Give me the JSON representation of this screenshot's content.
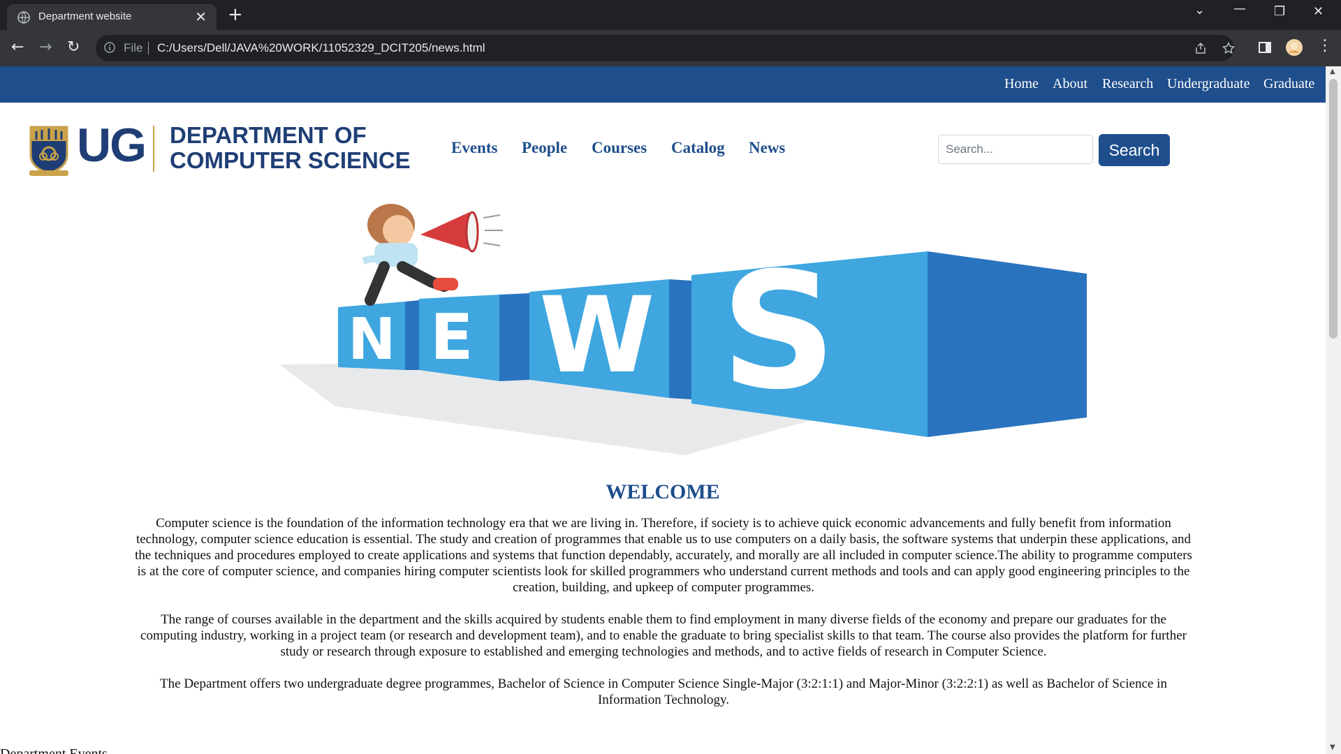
{
  "browser": {
    "tab_title": "Department website",
    "tab_close": "✕",
    "new_tab": "+",
    "address_scheme": "File",
    "address_url": "C:/Users/Dell/JAVA%20WORK/11052329_DCIT205/news.html",
    "controls": {
      "minimize": "—",
      "maximize": "❐",
      "close": "✕",
      "tab_search": "⌄"
    },
    "nav": {
      "back": "←",
      "forward": "→",
      "reload": "↻"
    }
  },
  "top_nav": {
    "links": [
      "Home",
      "About",
      "Research",
      "Undergraduate",
      "Graduate"
    ]
  },
  "brand": {
    "short": "UG",
    "line1": "DEPARTMENT OF",
    "line2": "COMPUTER SCIENCE"
  },
  "main_nav": {
    "links": [
      "Events",
      "People",
      "Courses",
      "Catalog",
      "News"
    ]
  },
  "search": {
    "placeholder": "Search...",
    "button_label": "Search"
  },
  "banner": {
    "letters": [
      "N",
      "E",
      "W",
      "S"
    ]
  },
  "content": {
    "heading": "WELCOME",
    "paragraphs": [
      "Computer science is the foundation of the information technology era that we are living in. Therefore, if society is to achieve quick economic advancements and fully benefit from information technology, computer science education is essential. The study and creation of programmes that enable us to use computers on a daily basis, the software systems that underpin these applications, and the techniques and procedures employed to create applications and systems that function dependably, accurately, and morally are all included in computer science.The ability to programme computers is at the core of computer science, and companies hiring computer scientists look for skilled programmers who understand current methods and tools and can apply good engineering principles to the creation, building, and upkeep of computer programmes.",
      "The range of courses available in the department and the skills acquired by students enable them to find employment in many diverse fields of the economy and prepare our graduates for the computing industry, working in a project team (or research and development team), and to enable the graduate to bring specialist skills to that team. The course also provides the platform for further study or research through exposure to established and emerging technologies and methods, and to active fields of research in Computer Science.",
      "The Department offers two undergraduate degree programmes, Bachelor of Science in Computer Science Single-Major (3:2:1:1) and Major-Minor (3:2:2:1) as well as Bachelor of Science in Information Technology."
    ],
    "cutoff_heading": "Department Events"
  },
  "colors": {
    "nav_blue": "#1f4e8c",
    "brand_navy": "#1f3e75",
    "cube_light": "#3fa6e0",
    "cube_dark": "#2a73bf"
  }
}
